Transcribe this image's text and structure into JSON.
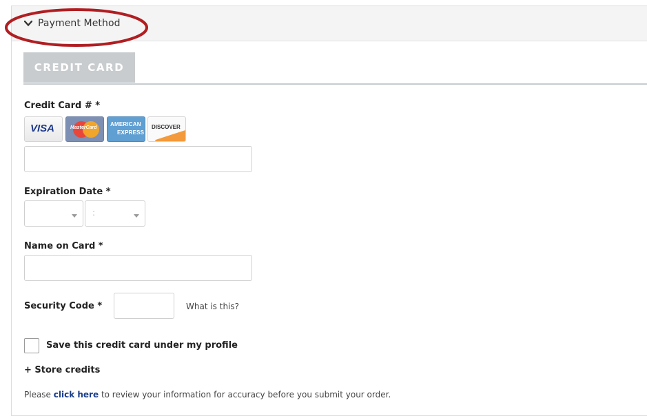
{
  "section": {
    "title": "Payment Method"
  },
  "tabs": [
    {
      "label": "CREDIT CARD"
    }
  ],
  "credit_card": {
    "label": "Credit Card # *",
    "value": "",
    "brands": [
      {
        "name": "visa",
        "text": "VISA"
      },
      {
        "name": "mastercard",
        "text": "MasterCard"
      },
      {
        "name": "amex",
        "line1": "AMERICAN",
        "line2": "EXPRESS"
      },
      {
        "name": "discover",
        "text": "DISCOVER"
      }
    ]
  },
  "expiration": {
    "label": "Expiration Date *",
    "month_value": "",
    "year_value": ":"
  },
  "name_on_card": {
    "label": "Name on Card *",
    "value": ""
  },
  "security_code": {
    "label": "Security Code *",
    "value": "",
    "help": "What is this?"
  },
  "save_card": {
    "label": "Save this credit card under my profile",
    "checked": false
  },
  "store_credits": {
    "label": "+ Store credits"
  },
  "review": {
    "prefix": "Please ",
    "link": "click here",
    "suffix": " to review your information for accuracy before you submit your order."
  },
  "colors": {
    "annotation": "#b01e22",
    "tab_bg": "#c8cccf",
    "link": "#1a3d8a"
  }
}
